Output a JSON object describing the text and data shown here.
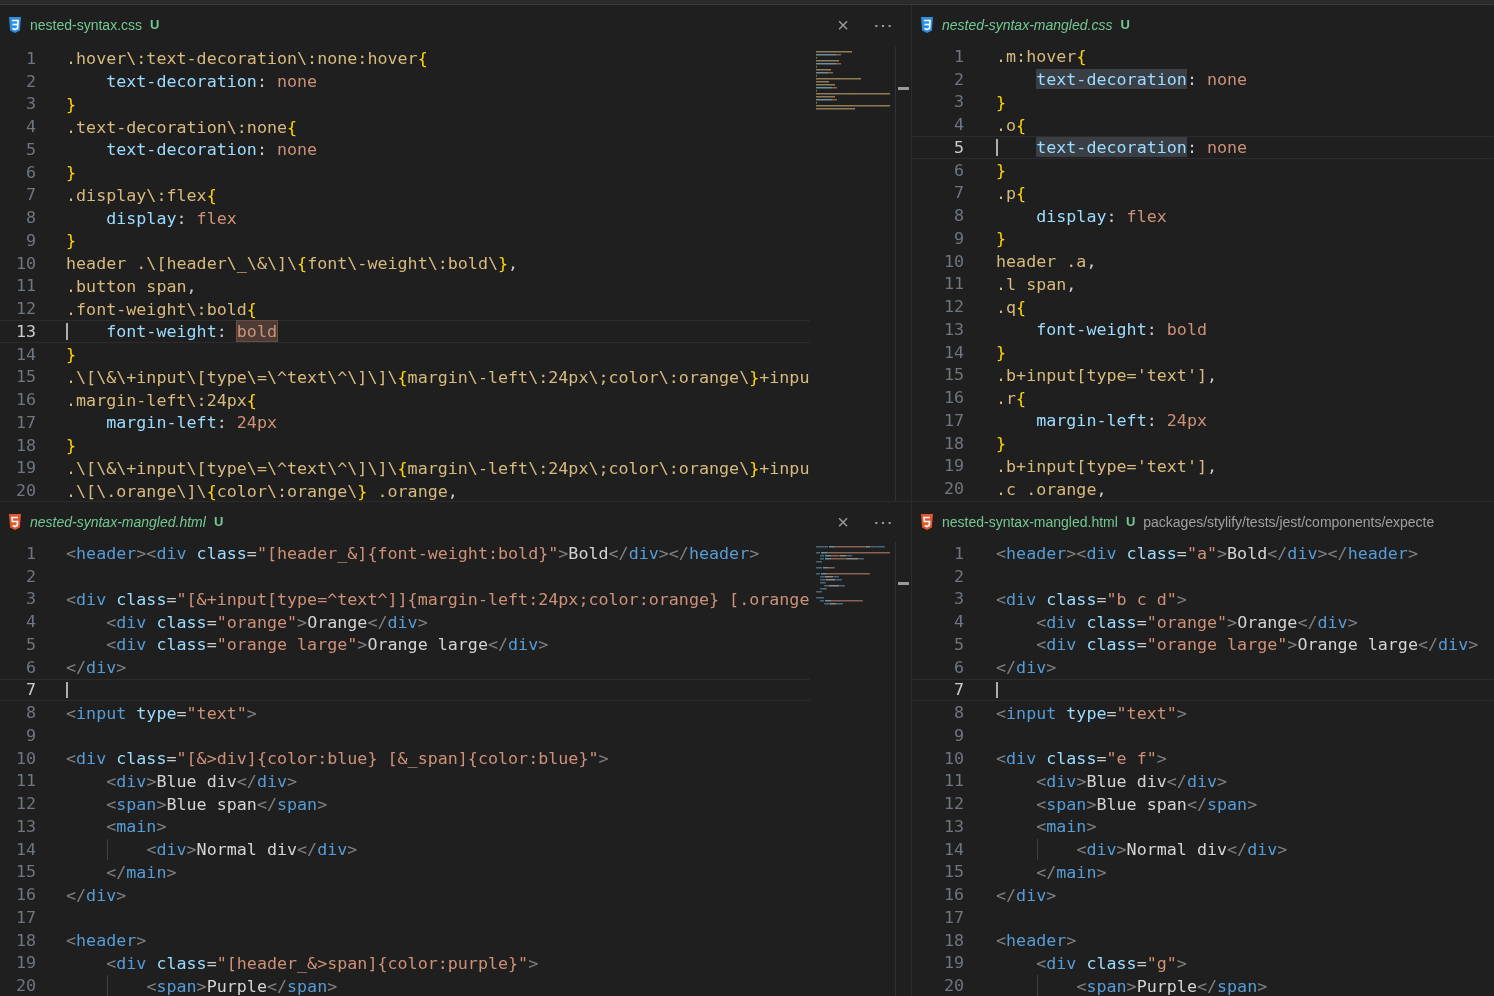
{
  "panes": [
    {
      "file": {
        "name": "nested-syntax.css",
        "kind": "css",
        "status": "U",
        "preview": false
      },
      "actions": [
        "×",
        "⋯"
      ],
      "minimap": true,
      "lines": [
        {
          "number": "1",
          "current": false,
          "text": ".hover\\:text-decoration\\:none:hover{"
        },
        {
          "number": "2",
          "current": false,
          "text": "    text-decoration: none"
        },
        {
          "number": "3",
          "current": false,
          "text": "}"
        },
        {
          "number": "4",
          "current": false,
          "text": ".text-decoration\\:none{"
        },
        {
          "number": "5",
          "current": false,
          "text": "    text-decoration: none"
        },
        {
          "number": "6",
          "current": false,
          "text": "}"
        },
        {
          "number": "7",
          "current": false,
          "text": ".display\\:flex{"
        },
        {
          "number": "8",
          "current": false,
          "text": "    display: flex"
        },
        {
          "number": "9",
          "current": false,
          "text": "}"
        },
        {
          "number": "10",
          "current": false,
          "text": "header .\\[header\\_\\&\\]\\{font\\-weight\\:bold\\},"
        },
        {
          "number": "11",
          "current": false,
          "text": ".button span,"
        },
        {
          "number": "12",
          "current": false,
          "text": ".font-weight\\:bold{"
        },
        {
          "number": "13",
          "current": true,
          "parts": [
            {
              "text": "    font-weight: ",
              "kind": "plain"
            },
            {
              "text": "bold",
              "kind": "match"
            }
          ]
        },
        {
          "number": "14",
          "current": false,
          "text": "}"
        },
        {
          "number": "15",
          "current": false,
          "text": ".\\[\\&\\+input\\[type\\=\\^text\\^\\]\\]\\{margin\\-left\\:24px\\;color\\:orange\\}+inpu"
        },
        {
          "number": "16",
          "current": false,
          "text": ".margin-left\\:24px{"
        },
        {
          "number": "17",
          "current": false,
          "text": "    margin-left: 24px"
        },
        {
          "number": "18",
          "current": false,
          "text": "}"
        },
        {
          "number": "19",
          "current": false,
          "text": ".\\[\\&\\+input\\[type\\=\\^text\\^\\]\\]\\{margin\\-left\\:24px\\;color\\:orange\\}+inpu"
        },
        {
          "number": "20",
          "current": false,
          "text": ".\\[\\.orange\\]\\{color\\:orange\\} .orange,"
        }
      ]
    },
    {
      "file": {
        "name": "nested-syntax-mangled.css",
        "kind": "css",
        "status": "U",
        "preview": true
      },
      "minimap": false,
      "lines": [
        {
          "number": "1",
          "current": false,
          "text": ".m:hover{"
        },
        {
          "number": "2",
          "current": false,
          "parts": [
            {
              "text": "    text-decoration",
              "kind": "selection"
            },
            {
              "text": ": none",
              "kind": "plain"
            }
          ]
        },
        {
          "number": "3",
          "current": false,
          "text": "}"
        },
        {
          "number": "4",
          "current": false,
          "text": ".o{"
        },
        {
          "number": "5",
          "current": true,
          "parts": [
            {
              "text": "    text-decoration",
              "kind": "selection"
            },
            {
              "text": ": none",
              "kind": "plain"
            }
          ]
        },
        {
          "number": "6",
          "current": false,
          "text": "}"
        },
        {
          "number": "7",
          "current": false,
          "text": ".p{"
        },
        {
          "number": "8",
          "current": false,
          "text": "    display: flex"
        },
        {
          "number": "9",
          "current": false,
          "text": "}"
        },
        {
          "number": "10",
          "current": false,
          "text": "header .a,"
        },
        {
          "number": "11",
          "current": false,
          "text": ".l span,"
        },
        {
          "number": "12",
          "current": false,
          "text": ".q{"
        },
        {
          "number": "13",
          "current": false,
          "text": "    font-weight: bold"
        },
        {
          "number": "14",
          "current": false,
          "text": "}"
        },
        {
          "number": "15",
          "current": false,
          "text": ".b+input[type='text'],"
        },
        {
          "number": "16",
          "current": false,
          "text": ".r{"
        },
        {
          "number": "17",
          "current": false,
          "text": "    margin-left: 24px"
        },
        {
          "number": "18",
          "current": false,
          "text": "}"
        },
        {
          "number": "19",
          "current": false,
          "text": ".b+input[type='text'],"
        },
        {
          "number": "20",
          "current": false,
          "text": ".c .orange,"
        }
      ]
    },
    {
      "file": {
        "name": "nested-syntax-mangled.html",
        "kind": "html",
        "status": "U",
        "preview": true
      },
      "actions": [
        "×",
        "⋯"
      ],
      "minimap": true,
      "lines": [
        {
          "number": "1",
          "current": false,
          "text": "<header><div class=\"[header_&]{font-weight:bold}\">Bold</div></header>"
        },
        {
          "number": "2",
          "current": false
        },
        {
          "number": "3",
          "current": false,
          "text": "<div class=\"[&+input[type=^text^]]{margin-left:24px;color:orange} [.orange"
        },
        {
          "number": "4",
          "current": false,
          "text": "    <div class=\"orange\">Orange</div>"
        },
        {
          "number": "5",
          "current": false,
          "text": "    <div class=\"orange large\">Orange large</div>"
        },
        {
          "number": "6",
          "current": false,
          "text": "</div>"
        },
        {
          "number": "7",
          "current": true
        },
        {
          "number": "8",
          "current": false,
          "text": "<input type=\"text\">"
        },
        {
          "number": "9",
          "current": false
        },
        {
          "number": "10",
          "current": false,
          "text": "<div class=\"[&>div]{color:blue} [&_span]{color:blue}\">"
        },
        {
          "number": "11",
          "current": false,
          "text": "    <div>Blue div</div>"
        },
        {
          "number": "12",
          "current": false,
          "text": "    <span>Blue span</span>"
        },
        {
          "number": "13",
          "current": false,
          "text": "    <main>"
        },
        {
          "number": "14",
          "current": false,
          "text": "        <div>Normal div</div>"
        },
        {
          "number": "15",
          "current": false,
          "text": "    </main>"
        },
        {
          "number": "16",
          "current": false,
          "text": "</div>"
        },
        {
          "number": "17",
          "current": false
        },
        {
          "number": "18",
          "current": false,
          "text": "<header>"
        },
        {
          "number": "19",
          "current": false,
          "text": "    <div class=\"[header_&>span]{color:purple}\">"
        },
        {
          "number": "20",
          "current": false,
          "text": "        <span>Purple</span>"
        }
      ]
    },
    {
      "file": {
        "name": "nested-syntax-mangled.html",
        "kind": "html",
        "status": "U",
        "preview": false,
        "path": "packages/stylify/tests/jest/components/expecte"
      },
      "minimap": false,
      "lines": [
        {
          "number": "1",
          "current": false,
          "text": "<header><div class=\"a\">Bold</div></header>"
        },
        {
          "number": "2",
          "current": false
        },
        {
          "number": "3",
          "current": false,
          "text": "<div class=\"b c d\">"
        },
        {
          "number": "4",
          "current": false,
          "text": "    <div class=\"orange\">Orange</div>"
        },
        {
          "number": "5",
          "current": false,
          "text": "    <div class=\"orange large\">Orange large</div>"
        },
        {
          "number": "6",
          "current": false,
          "text": "</div>"
        },
        {
          "number": "7",
          "current": true
        },
        {
          "number": "8",
          "current": false,
          "text": "<input type=\"text\">"
        },
        {
          "number": "9",
          "current": false
        },
        {
          "number": "10",
          "current": false,
          "text": "<div class=\"e f\">"
        },
        {
          "number": "11",
          "current": false,
          "text": "    <div>Blue div</div>"
        },
        {
          "number": "12",
          "current": false,
          "text": "    <span>Blue span</span>"
        },
        {
          "number": "13",
          "current": false,
          "text": "    <main>"
        },
        {
          "number": "14",
          "current": false,
          "text": "        <div>Normal div</div>"
        },
        {
          "number": "15",
          "current": false,
          "text": "    </main>"
        },
        {
          "number": "16",
          "current": false,
          "text": "</div>"
        },
        {
          "number": "17",
          "current": false
        },
        {
          "number": "18",
          "current": false,
          "text": "<header>"
        },
        {
          "number": "19",
          "current": false,
          "text": "    <div class=\"g\">"
        },
        {
          "number": "20",
          "current": false,
          "text": "        <span>Purple</span>"
        }
      ]
    }
  ]
}
